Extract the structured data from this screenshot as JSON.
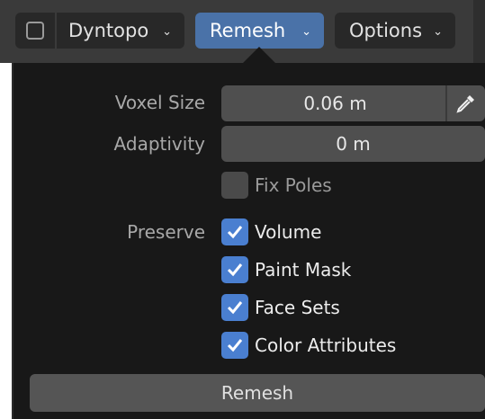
{
  "toolbar": {
    "dyntopo_label": "Dyntopo",
    "remesh_label": "Remesh",
    "options_label": "Options",
    "chevron": "⌄"
  },
  "panel": {
    "voxel_size_label": "Voxel Size",
    "voxel_size_value": "0.06 m",
    "adaptivity_label": "Adaptivity",
    "adaptivity_value": "0 m",
    "fix_poles_label": "Fix Poles",
    "fix_poles_checked": false,
    "preserve_label": "Preserve",
    "preserve_options": [
      {
        "label": "Volume",
        "checked": true
      },
      {
        "label": "Paint Mask",
        "checked": true
      },
      {
        "label": "Face Sets",
        "checked": true
      },
      {
        "label": "Color Attributes",
        "checked": true
      }
    ],
    "remesh_button_label": "Remesh"
  },
  "colors": {
    "accent": "#4a72a8",
    "checkbox_on": "#4a7fd0"
  }
}
